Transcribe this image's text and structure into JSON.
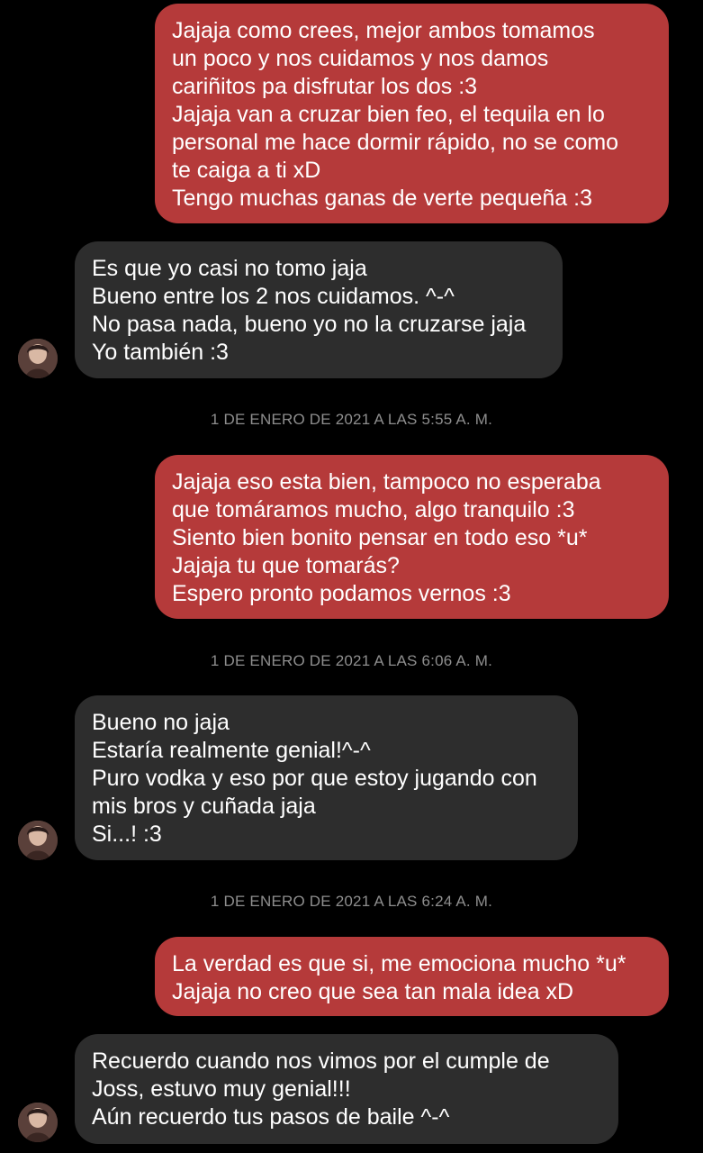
{
  "colors": {
    "background": "#000000",
    "outgoing_bubble": "#b53a3a",
    "incoming_bubble": "#2d2d2d",
    "timestamp": "#8e8e8e",
    "text": "#ffffff"
  },
  "messages": [
    {
      "direction": "outgoing",
      "lines": [
        "Jajaja como crees, mejor ambos tomamos",
        "un poco y nos cuidamos y nos damos",
        "cariñitos pa disfrutar los dos :3",
        "Jajaja van a cruzar bien feo, el tequila en lo",
        "personal me hace dormir rápido, no se como",
        "te caiga a ti xD",
        "Tengo muchas ganas de verte pequeña :3"
      ]
    },
    {
      "direction": "incoming",
      "avatar_icon": "contact-avatar",
      "lines": [
        "Es que yo casi no tomo jaja",
        "Bueno entre los 2 nos cuidamos. ^-^",
        "No pasa nada, bueno yo no la cruzarse jaja",
        "Yo también :3"
      ]
    },
    {
      "direction": "timestamp",
      "text": "1 DE ENERO DE 2021 A LAS 5:55 A. M."
    },
    {
      "direction": "outgoing",
      "lines": [
        "Jajaja eso esta bien, tampoco no esperaba",
        "que tomáramos mucho, algo tranquilo :3",
        "Siento bien bonito pensar en todo eso *u*",
        "Jajaja tu que tomarás?",
        "Espero pronto podamos vernos :3"
      ]
    },
    {
      "direction": "timestamp",
      "text": "1 DE ENERO DE 2021 A LAS 6:06 A. M."
    },
    {
      "direction": "incoming",
      "avatar_icon": "contact-avatar",
      "lines": [
        "Bueno no jaja",
        "Estaría realmente genial!^-^",
        "Puro vodka y eso por que estoy jugando con",
        "mis bros y cuñada jaja",
        "Si...! :3"
      ]
    },
    {
      "direction": "timestamp",
      "text": "1 DE ENERO DE 2021 A LAS 6:24 A. M."
    },
    {
      "direction": "outgoing",
      "lines": [
        "La verdad es que si, me emociona mucho *u*",
        "Jajaja no creo que sea tan mala idea xD"
      ]
    },
    {
      "direction": "incoming",
      "avatar_icon": "contact-avatar",
      "lines": [
        "Recuerdo cuando nos vimos por el cumple de",
        "Joss, estuvo muy genial!!!",
        "Aún recuerdo tus pasos de baile ^-^"
      ]
    }
  ]
}
